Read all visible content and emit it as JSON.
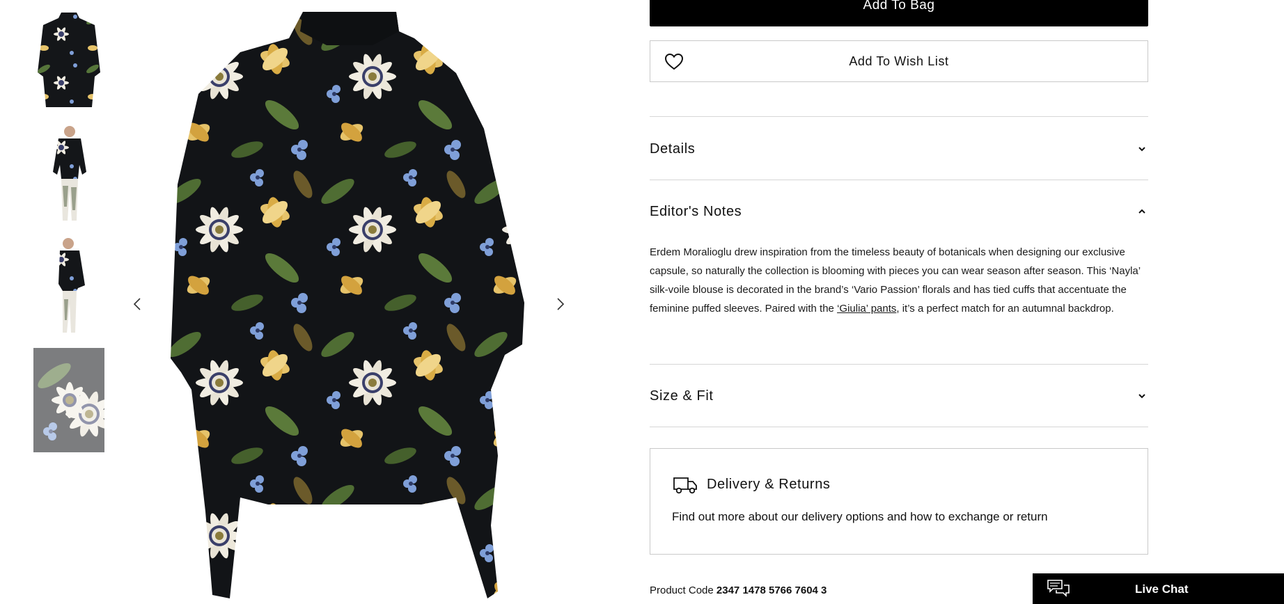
{
  "gallery": {
    "thumbnails": [
      "thumb-front",
      "thumb-model-front",
      "thumb-model-side",
      "thumb-fabric-detail"
    ],
    "prev_icon": "chevron-left-icon",
    "next_icon": "chevron-right-icon"
  },
  "actions": {
    "add_to_bag": "Add To Bag",
    "add_to_wishlist": "Add To Wish List",
    "wishlist_icon": "heart-icon"
  },
  "accordions": {
    "details": "Details",
    "editors_notes": "Editor's Notes",
    "size_fit": "Size & Fit"
  },
  "editors_notes": {
    "text_before_link": "Erdem Moralioglu drew inspiration from the timeless beauty of botanicals when designing our exclusive capsule, so naturally the collection is blooming with pieces you can wear season after season. This ‘Nayla’ silk-voile blouse is decorated in the brand’s ‘Vario Passion’ florals and has tied cuffs that accentuate the feminine puffed sleeves. Paired with the ",
    "link_text": "‘Giulia’ pants",
    "text_after_link": ", it’s a perfect match for an autumnal backdrop."
  },
  "delivery": {
    "title": "Delivery & Returns",
    "description": "Find out more about our delivery options and how to exchange or return",
    "icon": "truck-icon"
  },
  "product_code": {
    "label": "Product Code",
    "value": "2347 1478 5766 7604 3"
  },
  "live_chat": {
    "label": "Live Chat",
    "icon": "chat-bubbles-icon"
  },
  "colors": {
    "primary_button_bg": "#000000",
    "border": "#c9c9c9",
    "divider": "#d6d6d6",
    "print_bg": "#121417",
    "petal_cream": "#f1ede2",
    "petal_yellow": "#e6c36a",
    "leaf_green": "#5b7a3a",
    "flower_blue": "#7f9fd8"
  }
}
